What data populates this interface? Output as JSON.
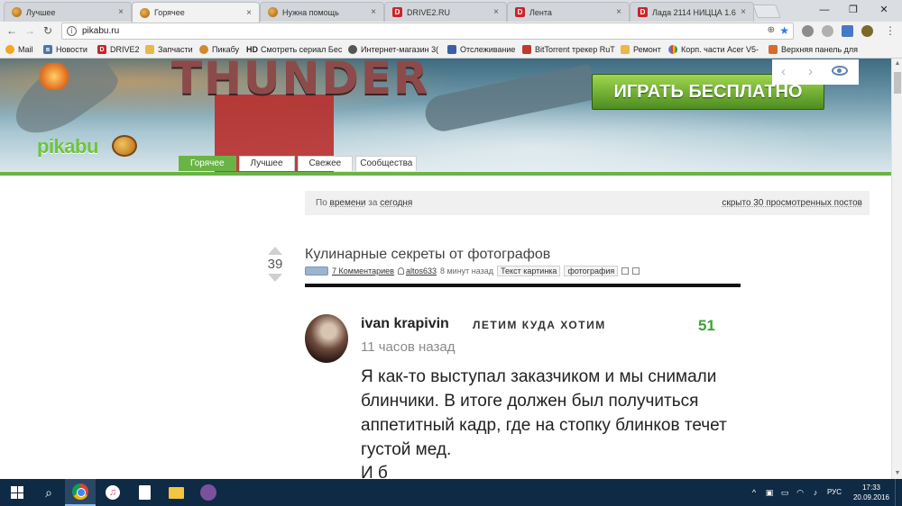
{
  "browser": {
    "tabs": [
      {
        "label": "Лучшее",
        "icon": "pikabu-favicon"
      },
      {
        "label": "Горячее",
        "icon": "pikabu-favicon",
        "active": true
      },
      {
        "label": "Нужна помощь",
        "icon": "pikabu-favicon"
      },
      {
        "label": "DRIVE2.RU",
        "icon": "drive2-favicon"
      },
      {
        "label": "Лента",
        "icon": "drive2-favicon"
      },
      {
        "label": "Лада 2114 НИЦЦА 1.6",
        "icon": "drive2-favicon"
      }
    ],
    "tab_close": "×",
    "win_minimize": "—",
    "win_restore": "❐",
    "win_close": "✕",
    "url": "pikabu.ru",
    "zoom_glyph": "⊕",
    "star_glyph": "★",
    "bookmarks": [
      {
        "label": "Mail"
      },
      {
        "label": "Новости"
      },
      {
        "label": "DRIVE2"
      },
      {
        "label": "Запчасти"
      },
      {
        "label": "Пикабу"
      },
      {
        "label": "Смотреть сериал Бес"
      },
      {
        "label": "Интернет-магазин 3("
      },
      {
        "label": "Отслеживание"
      },
      {
        "label": "BitTorrent трекер RuT"
      },
      {
        "label": "Ремонт"
      },
      {
        "label": "Корп. части Acer V5-"
      },
      {
        "label": "Верхняя панель для"
      }
    ],
    "hd_badge": "HD"
  },
  "banner": {
    "title": "THUNDER",
    "play_button": "ИГРАТЬ БЕСПЛАТНО",
    "prev_glyph": "‹",
    "next_glyph": "›"
  },
  "site": {
    "logo": "pikabu",
    "nav": [
      "Горячее",
      "Лучшее",
      "Свежее",
      "Сообщества"
    ],
    "filter": {
      "prefix": "По",
      "sort": "времени",
      "mid": "за",
      "period": "сегодня",
      "hidden": "скрыто 30 просмотренных постов"
    }
  },
  "post": {
    "rating": "39",
    "title": "Кулинарные секреты от фотографов",
    "comments": "7 Комментариев",
    "author": "altos633",
    "time": "8 минут назад",
    "tags": [
      "Текст картинка",
      "фотография"
    ]
  },
  "comment": {
    "name": "ivan krapivin",
    "motto": "ЛЕТИМ КУДА ХОТИМ",
    "rating": "51",
    "time": "11 часов назад",
    "text": "Я как-то выступал заказчиком и мы снимали блинчики. В итоге должен был получиться аппетитный кадр, где на стопку блинков течет густой мед.",
    "text_cont": "И      б"
  },
  "taskbar": {
    "lang": "РУС",
    "time": "17:33",
    "date": "20.09.2016"
  }
}
